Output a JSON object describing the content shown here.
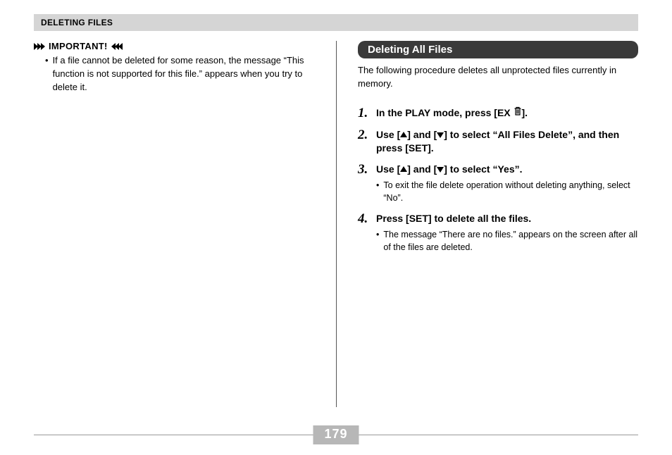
{
  "header": "DELETING FILES",
  "page_number": "179",
  "left": {
    "important_label": "IMPORTANT!",
    "bullet": "If a file cannot be deleted for some reason, the message “This function is not supported for this file.” appears when you try to delete it."
  },
  "right": {
    "section_title": "Deleting All Files",
    "intro": "The following procedure deletes all unprotected files currently in memory.",
    "steps": [
      {
        "num": "1.",
        "pre": "In the PLAY mode, press [EX ",
        "post": "].",
        "icon": "trash"
      },
      {
        "num": "2.",
        "text_parts": [
          "Use [",
          "UP",
          "] and [",
          "DOWN",
          "] to select “All Files Delete”, and then press [SET]."
        ]
      },
      {
        "num": "3.",
        "text_parts": [
          "Use [",
          "UP",
          "] and [",
          "DOWN",
          "] to select “Yes”."
        ],
        "sub": "To exit the file delete operation without deleting anything, select “No”."
      },
      {
        "num": "4.",
        "plain": "Press [SET] to delete all the files.",
        "sub": "The message “There are no files.” appears on the screen after all of the files are deleted."
      }
    ]
  }
}
